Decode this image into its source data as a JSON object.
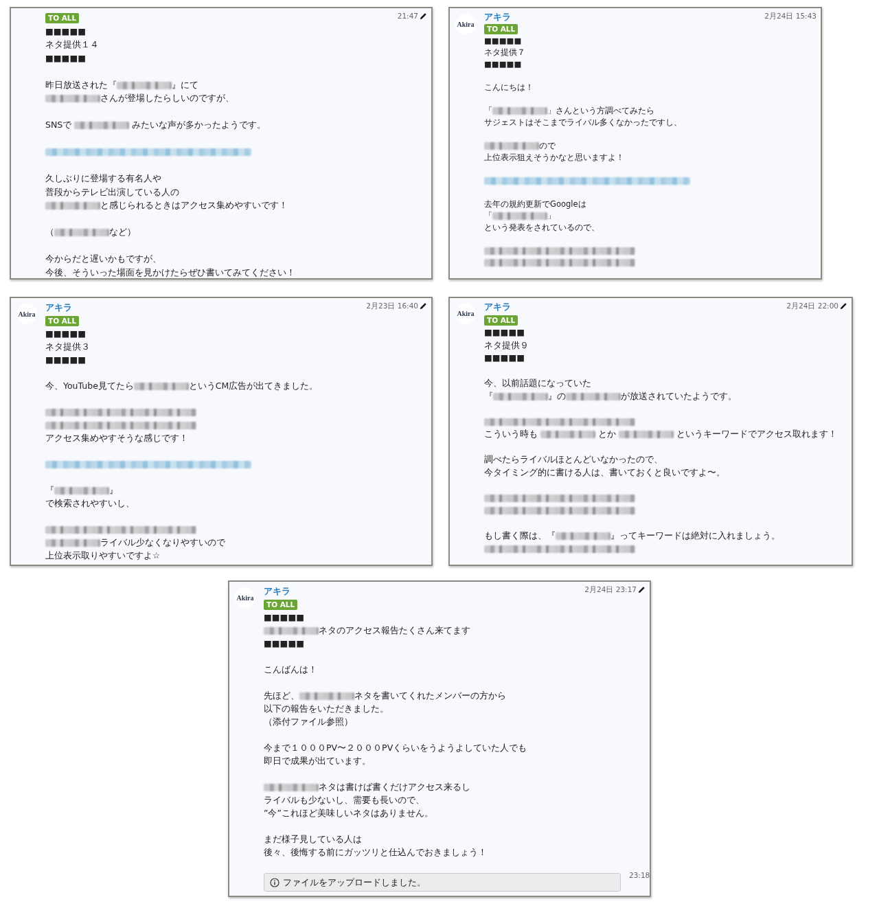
{
  "messages": [
    {
      "time": "21:47",
      "editable": true,
      "tag": "TO ALL",
      "paragraphs": [
        {
          "lines": [
            "■■■■■",
            "ネタ提供１４",
            "■■■■■"
          ]
        },
        {
          "lines": [
            [
              {
                "kind": "text",
                "text": "昨日放送された『"
              },
              {
                "kind": "blur"
              },
              {
                "kind": "text",
                "text": "』にて"
              }
            ],
            [
              {
                "kind": "blur"
              },
              {
                "kind": "text",
                "text": "さんが登場したらしいのですが、"
              }
            ]
          ]
        },
        {
          "lines": [
            [
              {
                "kind": "text",
                "text": "SNSで "
              },
              {
                "kind": "blur"
              },
              {
                "kind": "text",
                "text": " みたいな声が多かったようです。"
              }
            ]
          ]
        },
        {
          "lines": [
            [
              {
                "kind": "blur-link"
              }
            ]
          ]
        },
        {
          "lines": [
            "久しぶりに登場する有名人や",
            "普段からテレビ出演している人の",
            [
              {
                "kind": "blur"
              },
              {
                "kind": "text",
                "text": "と感じられるときはアクセス集めやすいです！"
              }
            ]
          ]
        },
        {
          "lines": [
            [
              {
                "kind": "text",
                "text": "（"
              },
              {
                "kind": "blur"
              },
              {
                "kind": "text",
                "text": "など）"
              }
            ]
          ]
        },
        {
          "lines": [
            "今からだと遅いかもですが、",
            "今後、そういった場面を見かけたらぜひ書いてみてください！"
          ]
        }
      ]
    },
    {
      "avatar_text": "Akira",
      "sender": "アキラ",
      "time": "2月24日 15:43",
      "editable": false,
      "tag": "TO ALL",
      "paragraphs": [
        {
          "lines": [
            "■■■■■",
            "ネタ提供７",
            "■■■■■"
          ]
        },
        {
          "lines": [
            "こんにちは！"
          ]
        },
        {
          "lines": [
            [
              {
                "kind": "text",
                "text": "「"
              },
              {
                "kind": "blur"
              },
              {
                "kind": "text",
                "text": "」さんという方調べてみたら"
              }
            ],
            "サジェストはそこまでライバル多くなかったですし、"
          ]
        },
        {
          "lines": [
            [
              {
                "kind": "blur"
              },
              {
                "kind": "text",
                "text": "ので"
              }
            ],
            "上位表示狙えそうかなと思いますよ！"
          ]
        },
        {
          "lines": [
            [
              {
                "kind": "blur-link"
              }
            ]
          ]
        },
        {
          "wide_gap": true,
          "lines": [
            "去年の規約更新でGoogleは",
            [
              {
                "kind": "text",
                "text": "「"
              },
              {
                "kind": "blur"
              },
              {
                "kind": "text",
                "text": "」"
              }
            ],
            "という発表をされているので、"
          ]
        },
        {
          "lines": [
            [
              {
                "kind": "blur"
              }
            ],
            [
              {
                "kind": "blur"
              }
            ]
          ]
        }
      ]
    },
    {
      "avatar_text": "Akira",
      "sender": "アキラ",
      "time": "2月23日 16:40",
      "editable": true,
      "tag": "TO ALL",
      "paragraphs": [
        {
          "lines": [
            "■■■■■",
            "ネタ提供３",
            "■■■■■"
          ]
        },
        {
          "lines": [
            [
              {
                "kind": "text",
                "text": "今、YouTube見てたら"
              },
              {
                "kind": "blur"
              },
              {
                "kind": "text",
                "text": "というCM広告が出てきました。"
              }
            ]
          ]
        },
        {
          "lines": [
            [
              {
                "kind": "blur"
              }
            ],
            [
              {
                "kind": "blur"
              }
            ],
            "アクセス集めやすそうな感じです！"
          ]
        },
        {
          "lines": [
            [
              {
                "kind": "blur-link"
              }
            ]
          ]
        },
        {
          "lines": [
            [
              {
                "kind": "text",
                "text": "『"
              },
              {
                "kind": "blur"
              },
              {
                "kind": "text",
                "text": "』"
              }
            ],
            "で検索されやすいし、"
          ]
        },
        {
          "lines": [
            [
              {
                "kind": "blur"
              }
            ],
            [
              {
                "kind": "blur"
              },
              {
                "kind": "text",
                "text": "ライバル少なくなりやすいので"
              }
            ],
            "上位表示取りやすいですよ☆"
          ]
        }
      ]
    },
    {
      "avatar_text": "Akira",
      "sender": "アキラ",
      "time": "2月24日 22:00",
      "editable": true,
      "tag": "TO ALL",
      "paragraphs": [
        {
          "lines": [
            "■■■■■",
            "ネタ提供９",
            "■■■■■"
          ]
        },
        {
          "lines": [
            "今、以前話題になっていた",
            [
              {
                "kind": "text",
                "text": "『"
              },
              {
                "kind": "blur"
              },
              {
                "kind": "text",
                "text": "』の"
              },
              {
                "kind": "blur"
              },
              {
                "kind": "text",
                "text": "が放送されていたようです。"
              }
            ]
          ]
        },
        {
          "lines": [
            [
              {
                "kind": "blur"
              }
            ],
            [
              {
                "kind": "text",
                "text": "こういう時も "
              },
              {
                "kind": "blur"
              },
              {
                "kind": "text",
                "text": " とか "
              },
              {
                "kind": "blur"
              },
              {
                "kind": "text",
                "text": " というキーワードでアクセス取れます！"
              }
            ]
          ]
        },
        {
          "lines": [
            "調べたらライバルほとんどいなかったので、",
            "今タイミング的に書ける人は、書いておくと良いですよ〜。"
          ]
        },
        {
          "lines": [
            [
              {
                "kind": "blur"
              }
            ],
            [
              {
                "kind": "blur"
              }
            ]
          ]
        },
        {
          "wide_gap": true,
          "lines": [
            [
              {
                "kind": "text",
                "text": "もし書く際は、『"
              },
              {
                "kind": "blur"
              },
              {
                "kind": "text",
                "text": "』ってキーワードは絶対に入れましょう。"
              }
            ],
            [
              {
                "kind": "blur"
              }
            ]
          ]
        }
      ]
    },
    {
      "avatar_text": "Akira",
      "sender": "アキラ",
      "time": "2月24日 23:17",
      "editable": true,
      "tag": "TO ALL",
      "paragraphs": [
        {
          "lines": [
            "■■■■■",
            [
              {
                "kind": "blur"
              },
              {
                "kind": "text",
                "text": "ネタのアクセス報告たくさん来てます"
              }
            ],
            "■■■■■"
          ]
        },
        {
          "lines": [
            "こんばんは！"
          ]
        },
        {
          "lines": [
            [
              {
                "kind": "text",
                "text": "先ほど、"
              },
              {
                "kind": "blur"
              },
              {
                "kind": "text",
                "text": "ネタを書いてくれたメンバーの方から"
              }
            ],
            "以下の報告をいただきました。",
            "（添付ファイル参照）"
          ]
        },
        {
          "lines": [
            "今まで１０００PV〜２０００PVくらいをうようよしていた人でも",
            "即日で成果が出ています。"
          ]
        },
        {
          "lines": [
            [
              {
                "kind": "blur"
              },
              {
                "kind": "text",
                "text": "ネタは書けば書くだけアクセス来るし"
              }
            ],
            "ライバルも少ないし、需要も長いので、",
            "”今”これほど美味しいネタはありません。"
          ]
        },
        {
          "lines": [
            "まだ様子見している人は",
            "後々、後悔する前にガッツリと仕込んでおきましょう！"
          ]
        }
      ],
      "attachment": {
        "notice": "ファイルをアップロードしました。",
        "time": "23:18"
      }
    }
  ]
}
